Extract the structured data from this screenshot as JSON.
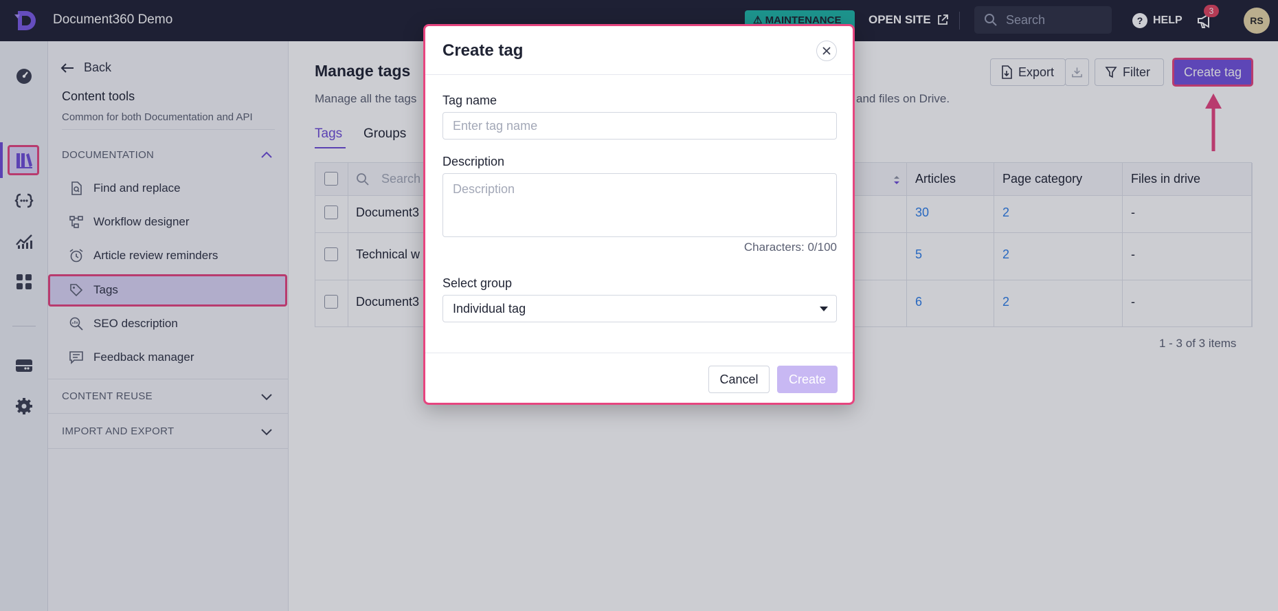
{
  "header": {
    "app_title": "Document360 Demo",
    "maintenance_label": "MAINTENANCE",
    "open_site_label": "OPEN SITE",
    "search_placeholder": "Search",
    "help_label": "HELP",
    "notification_count": "3",
    "avatar_initials": "RS"
  },
  "rail": {
    "icons": [
      "dashboard-icon",
      "documentation-icon",
      "api-icon",
      "analytics-icon",
      "apps-icon",
      "drive-icon",
      "settings-icon"
    ],
    "active": "documentation-icon"
  },
  "sidebar": {
    "back_label": "Back",
    "title": "Content tools",
    "subtitle": "Common for both Documentation and API",
    "sections": [
      {
        "label": "DOCUMENTATION",
        "expanded": true
      },
      {
        "label": "CONTENT REUSE",
        "expanded": false
      },
      {
        "label": "IMPORT AND EXPORT",
        "expanded": false
      }
    ],
    "items": [
      {
        "label": "Find and replace",
        "icon": "find-replace-icon"
      },
      {
        "label": "Workflow designer",
        "icon": "workflow-icon"
      },
      {
        "label": "Article review reminders",
        "icon": "alarm-clock-icon"
      },
      {
        "label": "Tags",
        "icon": "tag-icon",
        "active": true
      },
      {
        "label": "SEO description",
        "icon": "seo-icon"
      },
      {
        "label": "Feedback manager",
        "icon": "feedback-icon"
      }
    ]
  },
  "main": {
    "title": "Manage tags",
    "description_left": "Manage all the tags",
    "description_right": "and files on Drive.",
    "tabs": [
      "Tags",
      "Groups"
    ],
    "active_tab": "Tags",
    "export_label": "Export",
    "filter_label": "Filter",
    "create_tag_label": "Create tag",
    "table": {
      "search_placeholder": "Search",
      "columns": [
        "Articles",
        "Page category",
        "Files in drive"
      ],
      "rows": [
        {
          "name": "Document3",
          "articles": "30",
          "page_category": "2",
          "files": "-"
        },
        {
          "name": "Technical w",
          "articles": "5",
          "page_category": "2",
          "files": "-"
        },
        {
          "name": "Document3",
          "articles": "6",
          "page_category": "2",
          "files": "-"
        }
      ]
    },
    "pagination": "1 - 3 of 3 items"
  },
  "modal": {
    "title": "Create tag",
    "tag_name_label": "Tag name",
    "tag_name_placeholder": "Enter tag name",
    "tag_name_value": "",
    "description_label": "Description",
    "description_placeholder": "Description",
    "char_count": "Characters: 0/100",
    "select_group_label": "Select group",
    "select_group_value": "Individual tag",
    "cancel_label": "Cancel",
    "create_label": "Create"
  },
  "colors": {
    "accent": "#7152dd",
    "highlight": "#e6457f",
    "topbar": "#212235",
    "link": "#2d7ee8",
    "maintenance": "#1fb6a7"
  }
}
